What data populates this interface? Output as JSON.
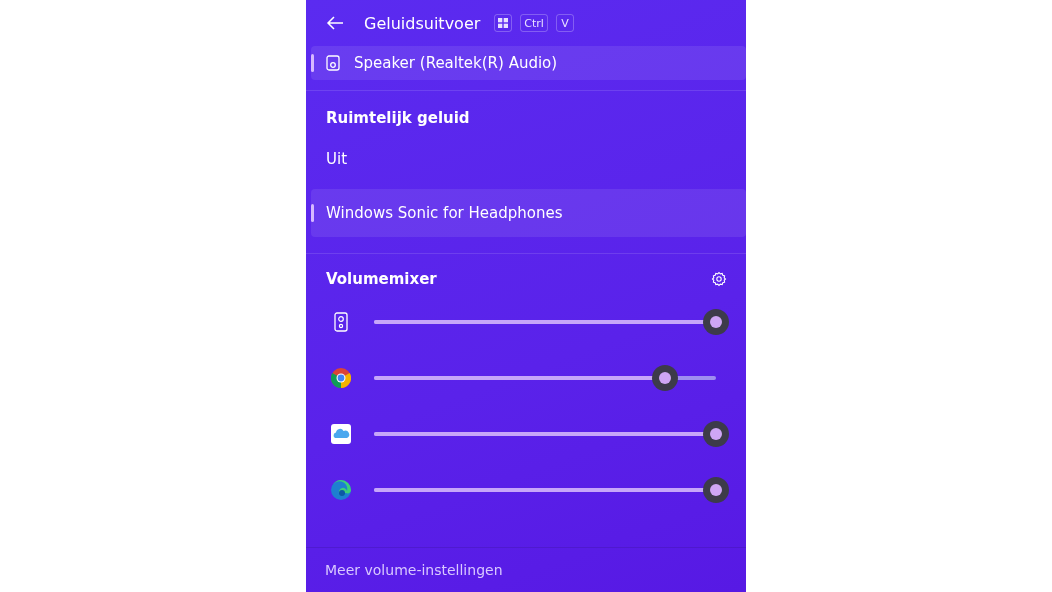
{
  "header": {
    "title": "Geluidsuitvoer",
    "shortcut_keys": [
      {
        "kind": "windows"
      },
      {
        "kind": "text",
        "label": "Ctrl"
      },
      {
        "kind": "text",
        "label": "V"
      }
    ]
  },
  "output_devices": [
    {
      "label": "Speaker (Realtek(R) Audio)",
      "selected": true
    }
  ],
  "spatial_sound": {
    "title": "Ruimtelijk geluid",
    "options": [
      {
        "label": "Uit",
        "selected": false
      },
      {
        "label": "Windows Sonic for Headphones",
        "selected": true
      }
    ]
  },
  "volume_mixer": {
    "title": "Volumemixer",
    "apps": [
      {
        "kind": "speaker",
        "level": 1
      },
      {
        "kind": "chrome",
        "level": 0.85
      },
      {
        "kind": "icloud",
        "level": 1
      },
      {
        "kind": "edge",
        "level": 1
      }
    ]
  },
  "footer": {
    "link": "Meer volume-instellingen"
  }
}
